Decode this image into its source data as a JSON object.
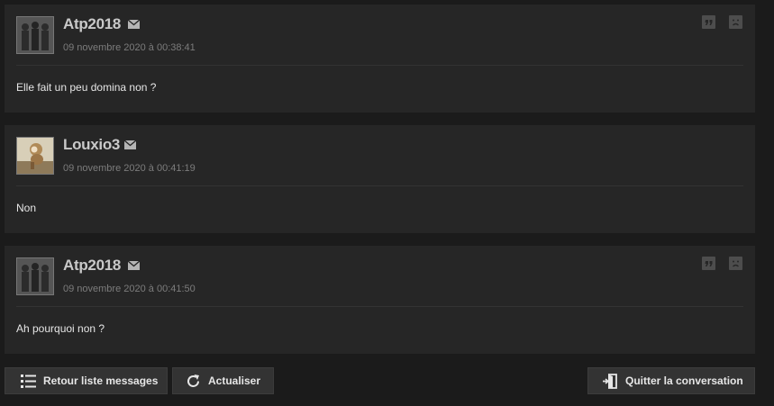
{
  "posts": [
    {
      "author": "Atp2018",
      "avatar": "silhouettes-avatar",
      "date": "09 novembre 2020 à 00:38:41",
      "message": "Elle fait un peu domina non ?",
      "tools": true
    },
    {
      "author": "Louxio3",
      "avatar": "monkey-avatar",
      "date": "09 novembre 2020 à 00:41:19",
      "message": "Non",
      "tools": false
    },
    {
      "author": "Atp2018",
      "avatar": "silhouettes-avatar",
      "date": "09 novembre 2020 à 00:41:50",
      "message": "Ah pourquoi non ?",
      "tools": true
    }
  ],
  "actions": {
    "back_label": "Retour liste messages",
    "refresh_label": "Actualiser",
    "leave_label": "Quitter la conversation"
  },
  "icons": {
    "mail": "mail-icon",
    "quote": "quote-icon",
    "report": "sad-face-icon",
    "list": "list-icon",
    "refresh": "refresh-icon",
    "exit": "exit-door-icon"
  },
  "colors": {
    "page_bg": "#1b1b1b",
    "post_bg": "#262626",
    "button_bg": "#333333",
    "text": "#e6e6e6",
    "muted": "#7c7c7c"
  }
}
